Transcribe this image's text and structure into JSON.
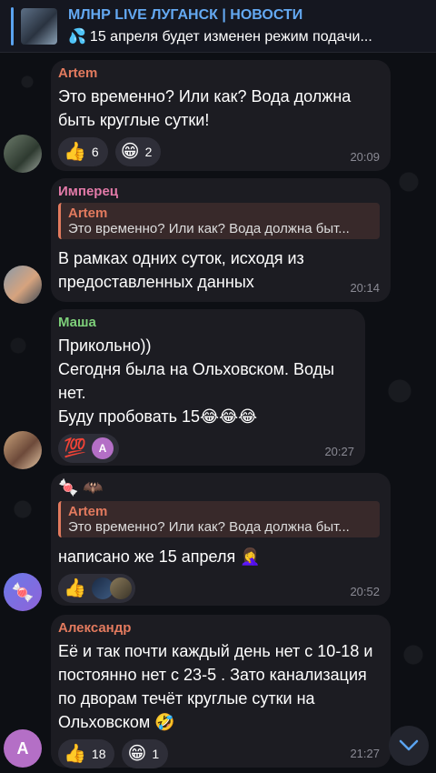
{
  "pinned": {
    "title": "МЛНР LIVE ЛУГАНСК | НОВОСТИ",
    "icon": "💦",
    "subtitle": "15 апреля будет изменен режим подачи..."
  },
  "messages": [
    {
      "author": "Artem",
      "author_color": "#e27a5e",
      "text": "Это временно? Или как? Вода должна быть круглые сутки!",
      "reactions": [
        {
          "icon": "👍",
          "count": "6"
        },
        {
          "icon": "😁",
          "count": "2"
        }
      ],
      "time": "20:09"
    },
    {
      "author": "Имперец",
      "author_color": "#e27aa8",
      "reply": {
        "author": "Artem",
        "text": "Это временно? Или как? Вода должна быт..."
      },
      "text": "В рамках одних суток, исходя из предоставленных данных",
      "time": "20:14"
    },
    {
      "author": "Маша",
      "author_color": "#7ed07a",
      "text_lines": [
        "Прикольно))",
        "Сегодня была на Ольховском. Воды нет.",
        "Буду пробовать 15😂😂😂"
      ],
      "reactions": [
        {
          "icon": "💯",
          "avatar": "A"
        }
      ],
      "time": "20:27"
    },
    {
      "sender_emoji": "🍬 🦇",
      "reply": {
        "author": "Artem",
        "text": "Это временно? Или как? Вода должна быт..."
      },
      "text": "написано же 15 апреля 🤦‍♀️",
      "reactions": [
        {
          "icon": "👍"
        }
      ],
      "time": "20:52"
    },
    {
      "author": "Александр",
      "author_color": "#e27a5e",
      "text": "Её и так почти каждый день нет с 10-18 и постоянно нет с 23-5 . Зато канализация по дворам течёт круглые сутки на Ольховском 🤣",
      "reactions": [
        {
          "icon": "👍",
          "count": "18"
        },
        {
          "icon": "😁",
          "count": "1"
        }
      ],
      "time": "21:27",
      "avatar": "A"
    }
  ],
  "colors": {
    "accent": "#64a9f2",
    "bubble": "#1c1c22"
  },
  "scroll_icon": "chevron-down-icon"
}
